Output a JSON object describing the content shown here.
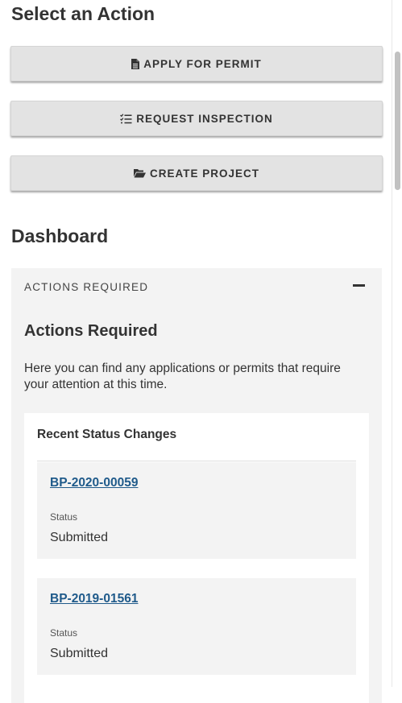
{
  "actions": {
    "title": "Select an Action",
    "buttons": [
      {
        "label": "APPLY FOR PERMIT",
        "icon": "file-icon"
      },
      {
        "label": "REQUEST INSPECTION",
        "icon": "checklist-icon"
      },
      {
        "label": "CREATE PROJECT",
        "icon": "folder-open-icon"
      }
    ]
  },
  "dashboard": {
    "title": "Dashboard",
    "panel": {
      "header": "ACTIONS REQUIRED",
      "collapse_icon": "minus-icon",
      "title": "Actions Required",
      "description": "Here you can find any applications or permits that require your attention at this time.",
      "card": {
        "title": "Recent Status Changes",
        "items": [
          {
            "permit": "BP-2020-00059",
            "status_label": "Status",
            "status": "Submitted"
          },
          {
            "permit": "BP-2019-01561",
            "status_label": "Status",
            "status": "Submitted"
          }
        ]
      }
    }
  },
  "colors": {
    "link": "#1f5a8a",
    "button_bg": "#e3e3e3",
    "panel_bg": "#f3f3f3",
    "text": "#333333"
  }
}
